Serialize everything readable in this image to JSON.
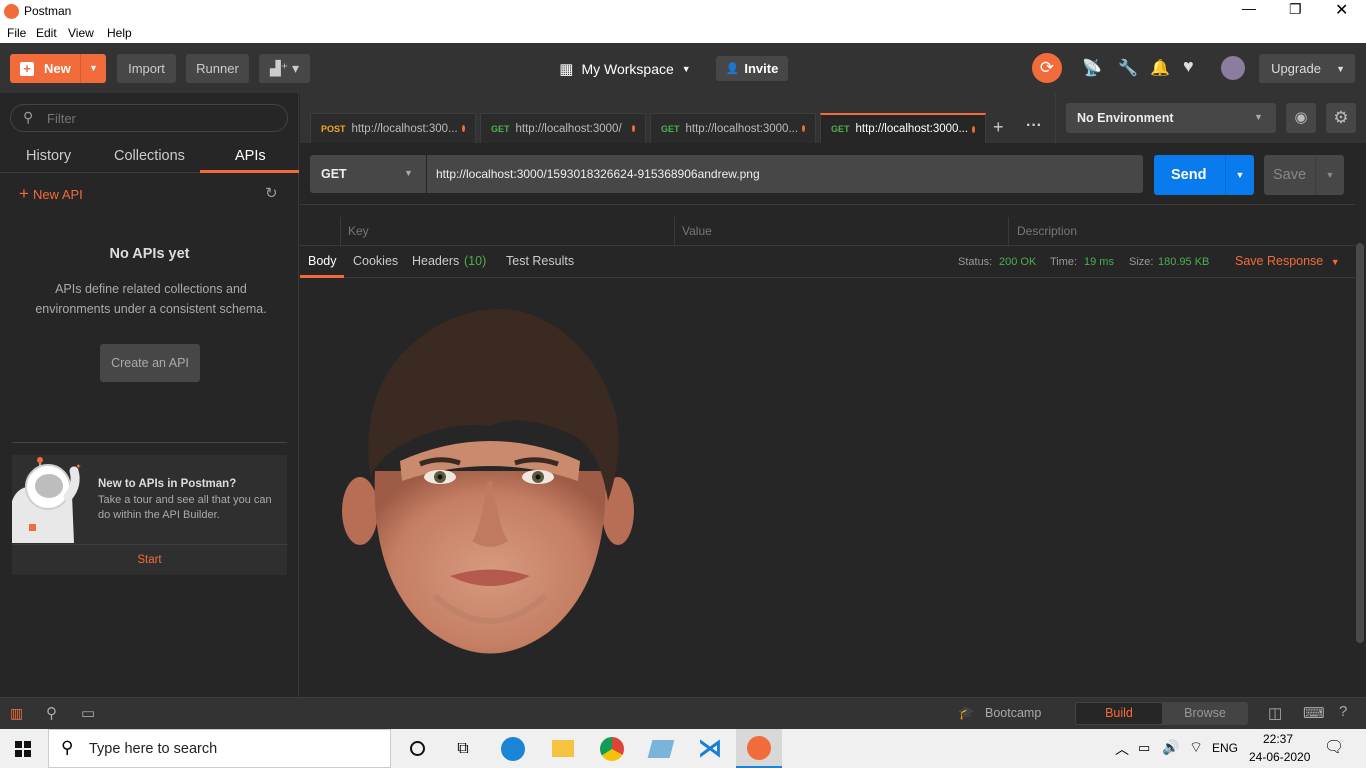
{
  "window": {
    "title": "Postman",
    "menu": [
      "File",
      "Edit",
      "View",
      "Help"
    ]
  },
  "toolbar": {
    "new_label": "New",
    "import_label": "Import",
    "runner_label": "Runner",
    "workspace_label": "My Workspace",
    "invite_label": "Invite",
    "upgrade_label": "Upgrade"
  },
  "sidebar": {
    "filter_placeholder": "Filter",
    "tabs": [
      "History",
      "Collections",
      "APIs"
    ],
    "new_api_label": "New API",
    "empty_title": "No APIs yet",
    "empty_desc": "APIs define related collections and environments under a consistent schema.",
    "create_button": "Create an API",
    "promo_title": "New to APIs in Postman?",
    "promo_desc": "Take a tour and see all that you can do within the API Builder.",
    "promo_start": "Start"
  },
  "tabs": [
    {
      "method": "POST",
      "url": "http://localhost:300...",
      "color": "#f5a623"
    },
    {
      "method": "GET",
      "url": "http://localhost:3000/",
      "color": "#4caf50"
    },
    {
      "method": "GET",
      "url": "http://localhost:3000...",
      "color": "#4caf50"
    },
    {
      "method": "GET",
      "url": "http://localhost:3000...",
      "color": "#4caf50"
    }
  ],
  "environment": {
    "selected": "No Environment"
  },
  "request": {
    "method": "GET",
    "url": "http://localhost:3000/1593018326624-915368906andrew.png",
    "send_label": "Send",
    "save_label": "Save"
  },
  "params_header": {
    "key": "Key",
    "value": "Value",
    "description": "Description"
  },
  "response": {
    "tabs": {
      "body": "Body",
      "cookies": "Cookies",
      "headers": "Headers",
      "headers_count": "(10)",
      "tests": "Test Results"
    },
    "status_label": "Status:",
    "status_value": "200 OK",
    "time_label": "Time:",
    "time_value": "19 ms",
    "size_label": "Size:",
    "size_value": "180.95 KB",
    "save_response": "Save Response"
  },
  "statusbar": {
    "bootcamp": "Bootcamp",
    "build": "Build",
    "browse": "Browse"
  },
  "taskbar": {
    "search_placeholder": "Type here to search",
    "lang": "ENG",
    "time": "22:37",
    "date": "24-06-2020"
  },
  "colors": {
    "accent": "#f26b3a",
    "send": "#097bed",
    "ok_green": "#4caf50"
  }
}
